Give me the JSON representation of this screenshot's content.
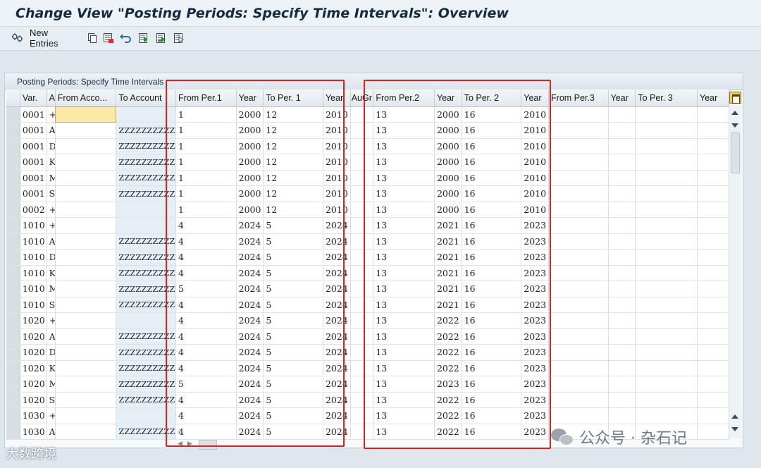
{
  "window": {
    "title": "Change View \"Posting Periods: Specify Time Intervals\": Overview"
  },
  "toolbar": {
    "new_entries_label": "New Entries",
    "icons": [
      "change-display-icon",
      "copy-icon",
      "delete-icon",
      "undo-icon",
      "select-all-icon",
      "select-block-icon",
      "deselect-all-icon"
    ]
  },
  "table": {
    "caption": "Posting Periods: Specify Time Intervals",
    "columns": [
      "Var.",
      "A",
      "From Acco...",
      "To Account",
      "From Per.1",
      "Year",
      "To Per. 1",
      "Year",
      "AuGr",
      "From Per.2",
      "Year",
      "To Per. 2",
      "Year",
      "From Per.3",
      "Year",
      "To Per. 3",
      "Year"
    ],
    "rows": [
      [
        "0001",
        "+",
        "",
        "",
        "1",
        "2000",
        "12",
        "2010",
        "",
        "13",
        "2000",
        "16",
        "2010",
        "",
        "",
        "",
        ""
      ],
      [
        "0001",
        "A",
        "",
        "ZZZZZZZZZZ",
        "1",
        "2000",
        "12",
        "2010",
        "",
        "13",
        "2000",
        "16",
        "2010",
        "",
        "",
        "",
        ""
      ],
      [
        "0001",
        "D",
        "",
        "ZZZZZZZZZZ",
        "1",
        "2000",
        "12",
        "2010",
        "",
        "13",
        "2000",
        "16",
        "2010",
        "",
        "",
        "",
        ""
      ],
      [
        "0001",
        "K",
        "",
        "ZZZZZZZZZZ",
        "1",
        "2000",
        "12",
        "2010",
        "",
        "13",
        "2000",
        "16",
        "2010",
        "",
        "",
        "",
        ""
      ],
      [
        "0001",
        "M",
        "",
        "ZZZZZZZZZZ",
        "1",
        "2000",
        "12",
        "2010",
        "",
        "13",
        "2000",
        "16",
        "2010",
        "",
        "",
        "",
        ""
      ],
      [
        "0001",
        "S",
        "",
        "ZZZZZZZZZZ",
        "1",
        "2000",
        "12",
        "2010",
        "",
        "13",
        "2000",
        "16",
        "2010",
        "",
        "",
        "",
        ""
      ],
      [
        "0002",
        "+",
        "",
        "",
        "1",
        "2000",
        "12",
        "2010",
        "",
        "13",
        "2000",
        "16",
        "2010",
        "",
        "",
        "",
        ""
      ],
      [
        "1010",
        "+",
        "",
        "",
        "4",
        "2024",
        "5",
        "2024",
        "",
        "13",
        "2021",
        "16",
        "2023",
        "",
        "",
        "",
        ""
      ],
      [
        "1010",
        "A",
        "",
        "ZZZZZZZZZZ",
        "4",
        "2024",
        "5",
        "2024",
        "",
        "13",
        "2021",
        "16",
        "2023",
        "",
        "",
        "",
        ""
      ],
      [
        "1010",
        "D",
        "",
        "ZZZZZZZZZZ",
        "4",
        "2024",
        "5",
        "2024",
        "",
        "13",
        "2021",
        "16",
        "2023",
        "",
        "",
        "",
        ""
      ],
      [
        "1010",
        "K",
        "",
        "ZZZZZZZZZZ",
        "4",
        "2024",
        "5",
        "2024",
        "",
        "13",
        "2021",
        "16",
        "2023",
        "",
        "",
        "",
        ""
      ],
      [
        "1010",
        "M",
        "",
        "ZZZZZZZZZZ",
        "5",
        "2024",
        "5",
        "2024",
        "",
        "13",
        "2021",
        "16",
        "2023",
        "",
        "",
        "",
        ""
      ],
      [
        "1010",
        "S",
        "",
        "ZZZZZZZZZZ",
        "4",
        "2024",
        "5",
        "2024",
        "",
        "13",
        "2021",
        "16",
        "2023",
        "",
        "",
        "",
        ""
      ],
      [
        "1020",
        "+",
        "",
        "",
        "4",
        "2024",
        "5",
        "2024",
        "",
        "13",
        "2022",
        "16",
        "2023",
        "",
        "",
        "",
        ""
      ],
      [
        "1020",
        "A",
        "",
        "ZZZZZZZZZZ",
        "4",
        "2024",
        "5",
        "2024",
        "",
        "13",
        "2022",
        "16",
        "2023",
        "",
        "",
        "",
        ""
      ],
      [
        "1020",
        "D",
        "",
        "ZZZZZZZZZZ",
        "4",
        "2024",
        "5",
        "2024",
        "",
        "13",
        "2022",
        "16",
        "2023",
        "",
        "",
        "",
        ""
      ],
      [
        "1020",
        "K",
        "",
        "ZZZZZZZZZZ",
        "4",
        "2024",
        "5",
        "2024",
        "",
        "13",
        "2022",
        "16",
        "2023",
        "",
        "",
        "",
        ""
      ],
      [
        "1020",
        "M",
        "",
        "ZZZZZZZZZZ",
        "5",
        "2024",
        "5",
        "2024",
        "",
        "13",
        "2023",
        "16",
        "2023",
        "",
        "",
        "",
        ""
      ],
      [
        "1020",
        "S",
        "",
        "ZZZZZZZZZZ",
        "4",
        "2024",
        "5",
        "2024",
        "",
        "13",
        "2022",
        "16",
        "2023",
        "",
        "",
        "",
        ""
      ],
      [
        "1030",
        "+",
        "",
        "",
        "4",
        "2024",
        "5",
        "2024",
        "",
        "13",
        "2022",
        "16",
        "2023",
        "",
        "",
        "",
        ""
      ],
      [
        "1030",
        "A",
        "",
        "ZZZZZZZZZZ",
        "4",
        "2024",
        "5",
        "2024",
        "",
        "13",
        "2022",
        "16",
        "2023",
        "",
        "",
        "",
        ""
      ]
    ]
  },
  "watermarks": {
    "left": "大数跨境",
    "right": "公众号 · 杂石记"
  },
  "colors": {
    "highlight_box": "#e0201e",
    "active_cell": "#fbe9a7",
    "title_text": "#142a44"
  }
}
